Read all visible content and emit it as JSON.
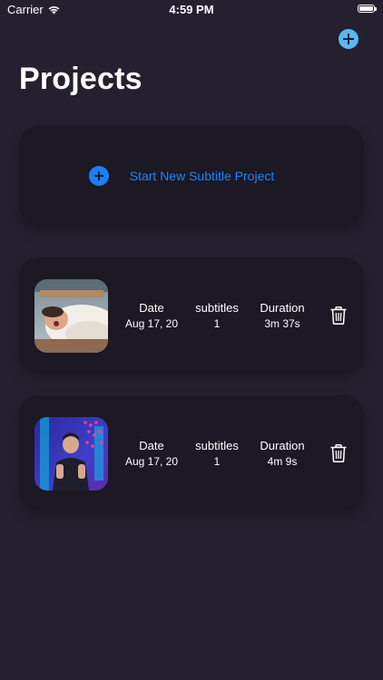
{
  "status_bar": {
    "carrier": "Carrier",
    "time": "4:59 PM",
    "battery_level": 1.0
  },
  "header": {
    "add_icon": "plus-circle-icon",
    "title": "Projects"
  },
  "new_project": {
    "icon": "plus-circle-icon",
    "label": "Start New Subtitle Project"
  },
  "columns": {
    "date": "Date",
    "subtitles": "subtitles",
    "duration": "Duration"
  },
  "projects": [
    {
      "thumbnail": "sleeping-person-photo",
      "date": "Aug 17, 20",
      "subtitles": "1",
      "duration": "3m 37s",
      "delete_icon": "trash-icon"
    },
    {
      "thumbnail": "stage-performer-photo",
      "date": "Aug 17, 20",
      "subtitles": "1",
      "duration": "4m 9s",
      "delete_icon": "trash-icon"
    }
  ],
  "colors": {
    "background": "#25202e",
    "card": "#1c1824",
    "accent_blue": "#1f84f5",
    "top_add": "#5ab7f3"
  }
}
